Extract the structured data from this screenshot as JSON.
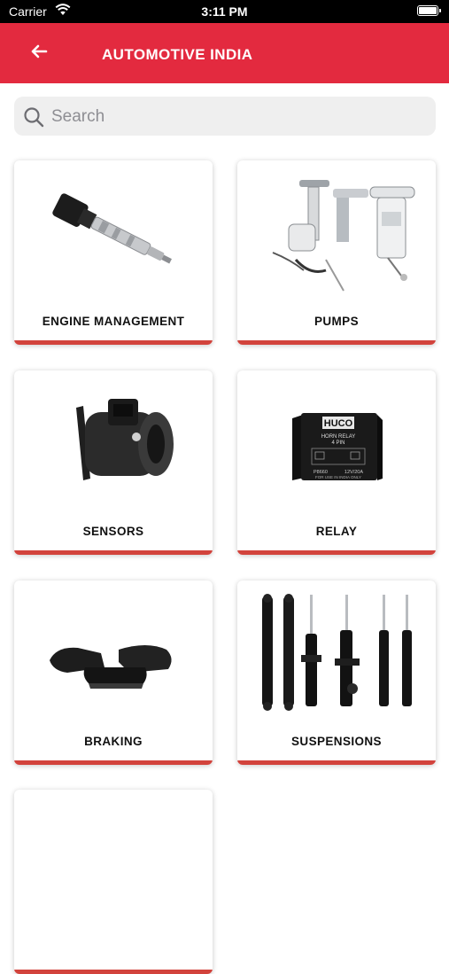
{
  "status": {
    "carrier": "Carrier",
    "time": "3:11 PM"
  },
  "header": {
    "title": "AUTOMOTIVE INDIA"
  },
  "search": {
    "placeholder": "Search"
  },
  "categories": [
    {
      "label": "ENGINE MANAGEMENT",
      "icon": "ignition-coil-icon"
    },
    {
      "label": "PUMPS",
      "icon": "fuel-pump-icon"
    },
    {
      "label": "SENSORS",
      "icon": "airflow-sensor-icon"
    },
    {
      "label": "RELAY",
      "icon": "relay-icon"
    },
    {
      "label": "BRAKING",
      "icon": "brake-pads-icon"
    },
    {
      "label": "SUSPENSIONS",
      "icon": "shock-absorbers-icon"
    }
  ],
  "relay_image_text": {
    "brand": "HUCO",
    "line1": "HORN RELAY",
    "line2": "4 PIN",
    "part": "P8660",
    "rating": "12V/20A",
    "origin": "FOR USE IN INDIA ONLY"
  },
  "colors": {
    "accent": "#e32a3f",
    "card_bar": "#d2433c"
  }
}
